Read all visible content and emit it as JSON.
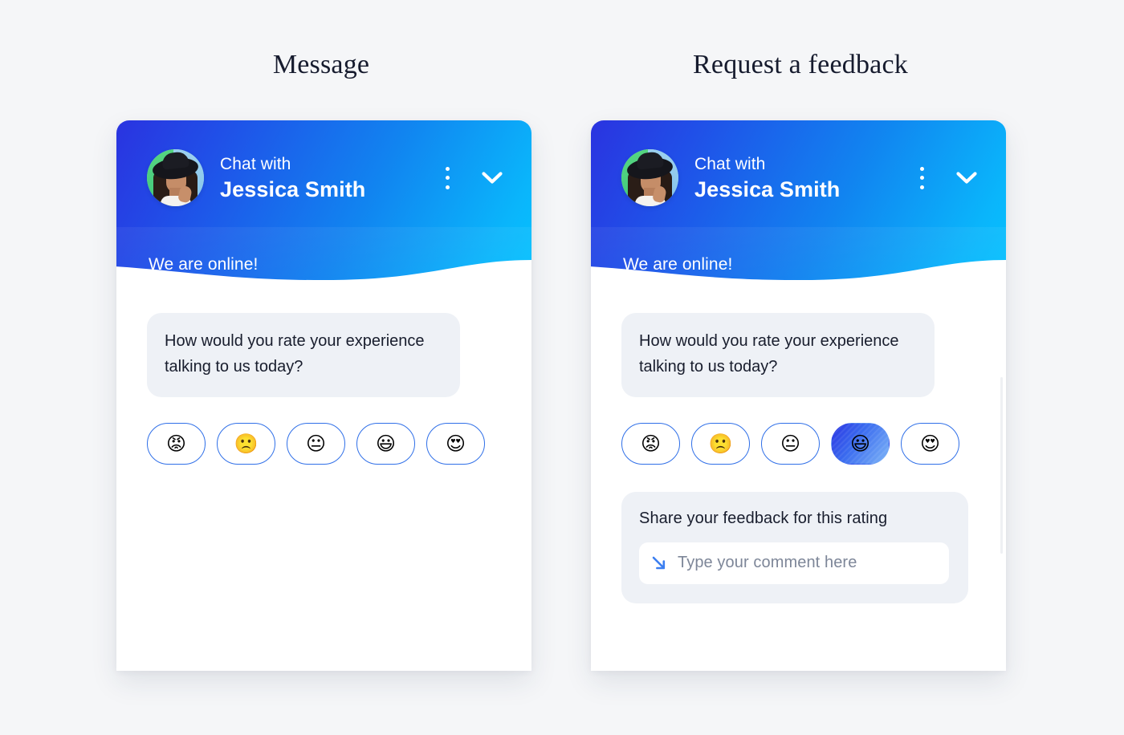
{
  "panels": [
    {
      "title": "Message",
      "header": {
        "eyebrow": "Chat with",
        "name": "Jessica Smith",
        "status": "We are online!",
        "menu_icon": "kebab-menu-icon",
        "collapse_icon": "chevron-down-icon",
        "avatar_alt": "Jessica Smith avatar"
      },
      "message": "How would you rate your experience talking to us today?",
      "ratings": [
        {
          "name": "angry",
          "emoji": "😡",
          "selected": false
        },
        {
          "name": "frowning",
          "emoji": "🙁",
          "selected": false
        },
        {
          "name": "neutral",
          "emoji": "😐",
          "selected": false
        },
        {
          "name": "grinning",
          "emoji": "😃",
          "selected": false
        },
        {
          "name": "heart-eyes",
          "emoji": "😍",
          "selected": false
        }
      ],
      "feedback": null
    },
    {
      "title": "Request a feedback",
      "header": {
        "eyebrow": "Chat with",
        "name": "Jessica Smith",
        "status": "We are online!",
        "menu_icon": "kebab-menu-icon",
        "collapse_icon": "chevron-down-icon",
        "avatar_alt": "Jessica Smith avatar"
      },
      "message": "How would you rate your experience talking to us today?",
      "ratings": [
        {
          "name": "angry",
          "emoji": "😡",
          "selected": false
        },
        {
          "name": "frowning",
          "emoji": "🙁",
          "selected": false
        },
        {
          "name": "neutral",
          "emoji": "😐",
          "selected": false
        },
        {
          "name": "grinning",
          "emoji": "😃",
          "selected": true
        },
        {
          "name": "heart-eyes",
          "emoji": "😍",
          "selected": false
        }
      ],
      "feedback": {
        "label": "Share your feedback for this rating",
        "input_value": "",
        "input_placeholder": "Type your comment here",
        "input_icon": "arrow-down-right-icon"
      }
    }
  ],
  "colors": {
    "page_background": "#f5f6f8",
    "header_gradient_start": "#2a33e0",
    "header_gradient_end": "#05c3ff",
    "accent_blue": "#2f6fe8",
    "bubble_background": "#eef1f6",
    "text_dark": "#181d2d",
    "placeholder_grey": "#7d8698"
  }
}
